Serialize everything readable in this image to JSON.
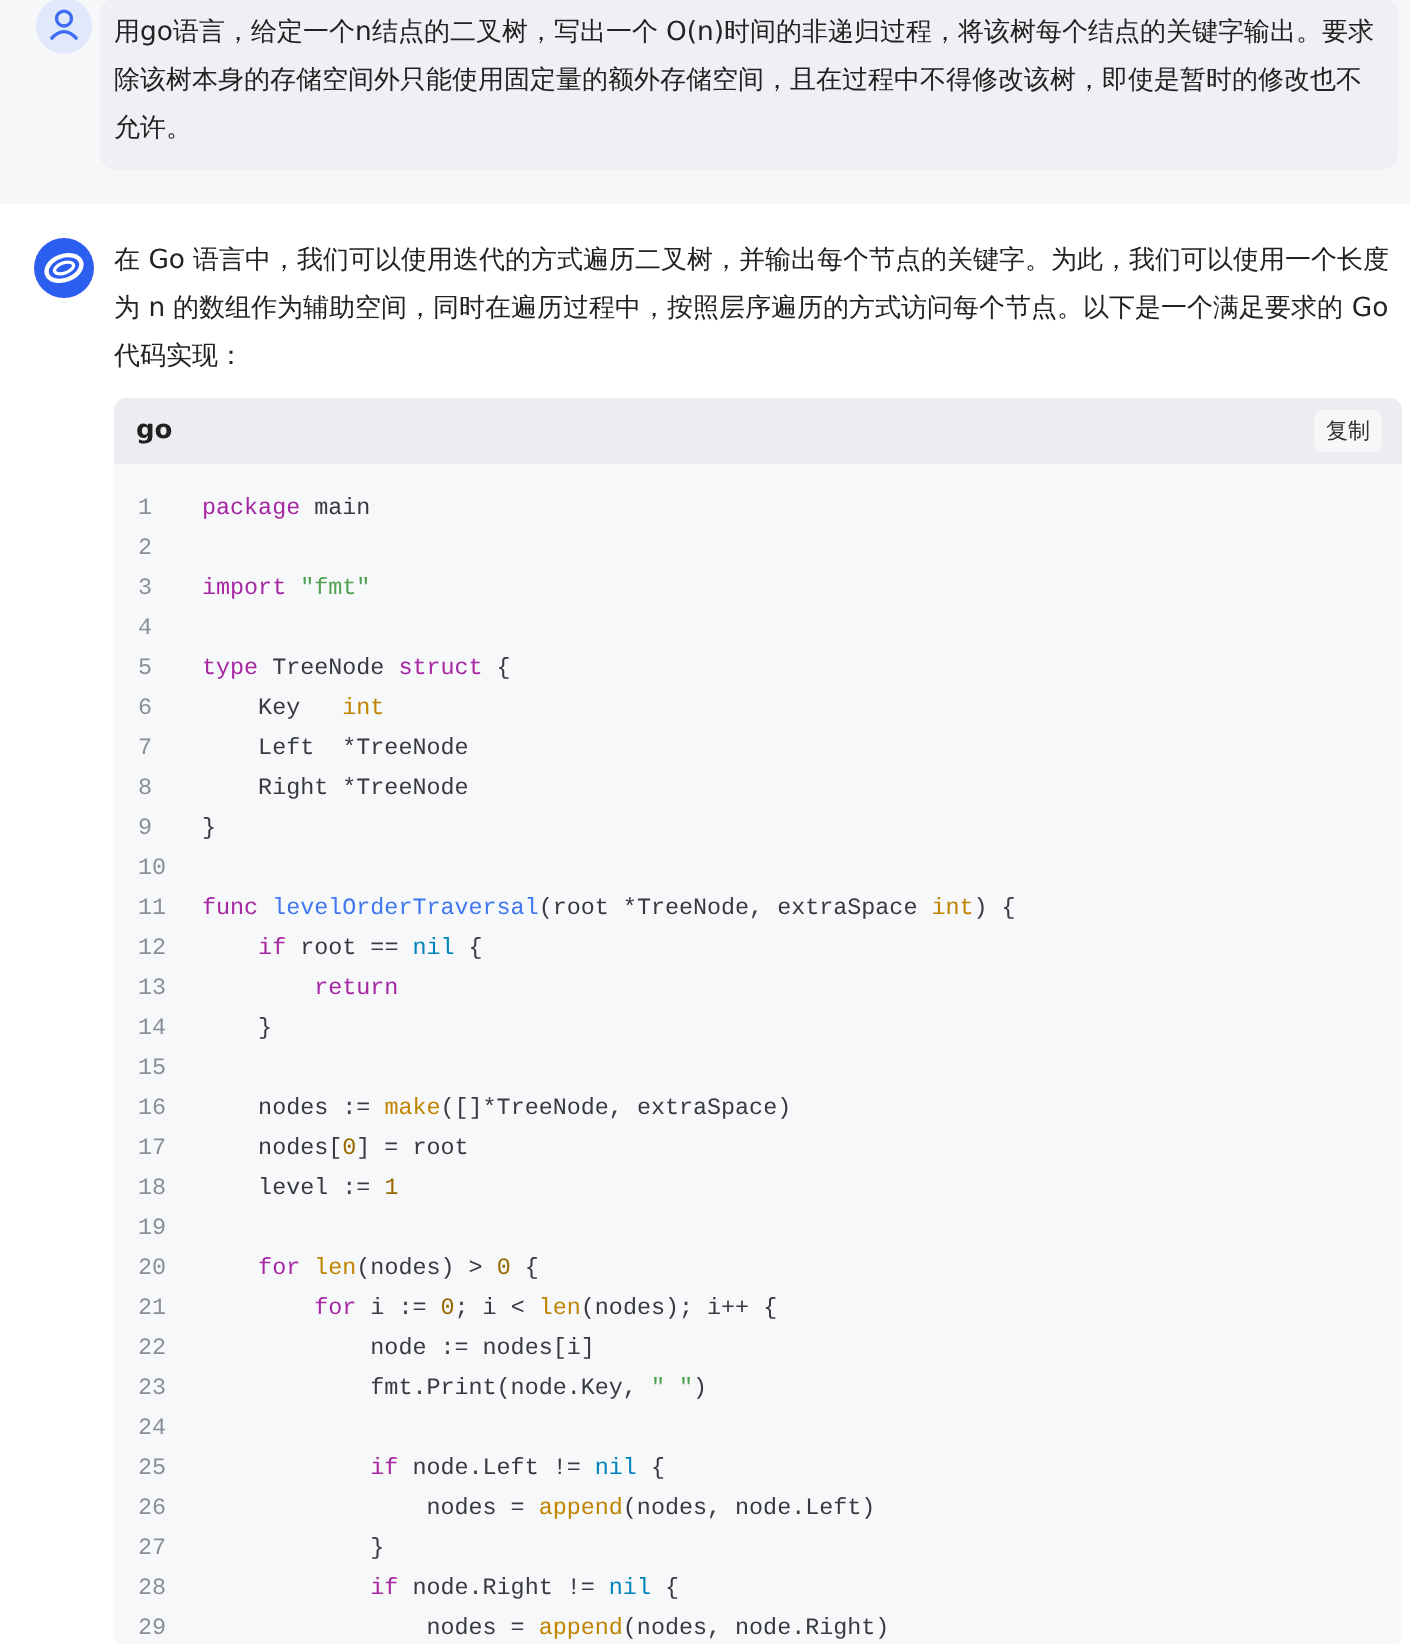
{
  "question": {
    "text": "用go语言，给定一个n结点的二叉树，写出一个 O(n)时间的非递归过程，将该树每个结点的关键字输出。要求除该树本身的存储空间外只能使用固定量的额外存储空间，且在过程中不得修改该树，即使是暂时的修改也不允许。"
  },
  "answer": {
    "text": "在 Go 语言中，我们可以使用迭代的方式遍历二叉树，并输出每个节点的关键字。为此，我们可以使用一个长度为 n 的数组作为辅助空间，同时在遍历过程中，按照层序遍历的方式访问每个节点。以下是一个满足要求的 Go 代码实现：",
    "code": {
      "language": "go",
      "copy_label": "复制",
      "lines": [
        {
          "number": "1",
          "tokens": [
            {
              "kind": "keyword",
              "text": "package"
            },
            {
              "kind": "plain",
              "text": " main"
            }
          ]
        },
        {
          "number": "2"
        },
        {
          "number": "3",
          "tokens": [
            {
              "kind": "keyword",
              "text": "import "
            },
            {
              "kind": "string",
              "text": "\"fmt\""
            }
          ]
        },
        {
          "number": "4"
        },
        {
          "number": "5",
          "tokens": [
            {
              "kind": "keyword",
              "text": "type"
            },
            {
              "kind": "plain",
              "text": " TreeNode "
            },
            {
              "kind": "keyword",
              "text": "struct"
            },
            {
              "kind": "plain",
              "text": " {"
            }
          ]
        },
        {
          "number": "6",
          "tokens": [
            {
              "kind": "plain",
              "text": "    Key   "
            },
            {
              "kind": "builtin",
              "text": "int"
            }
          ]
        },
        {
          "number": "7",
          "tokens": [
            {
              "kind": "plain",
              "text": "    Left  *TreeNode"
            }
          ]
        },
        {
          "number": "8",
          "tokens": [
            {
              "kind": "plain",
              "text": "    Right *TreeNode"
            }
          ]
        },
        {
          "number": "9",
          "tokens": [
            {
              "kind": "plain",
              "text": "}"
            }
          ]
        },
        {
          "number": "10"
        },
        {
          "number": "11",
          "tokens": [
            {
              "kind": "keyword",
              "text": "func"
            },
            {
              "kind": "function",
              "text": " levelOrderTraversal"
            },
            {
              "kind": "plain",
              "text": "(root *TreeNode, extraSpace "
            },
            {
              "kind": "builtin",
              "text": "int"
            },
            {
              "kind": "plain",
              "text": ") {"
            }
          ]
        },
        {
          "number": "12",
          "tokens": [
            {
              "kind": "keyword",
              "text": "    if"
            },
            {
              "kind": "plain",
              "text": " root == "
            },
            {
              "kind": "literal",
              "text": "nil"
            },
            {
              "kind": "plain",
              "text": " {"
            }
          ]
        },
        {
          "number": "13",
          "tokens": [
            {
              "kind": "keyword",
              "text": "        return"
            }
          ]
        },
        {
          "number": "14",
          "tokens": [
            {
              "kind": "plain",
              "text": "    }"
            }
          ]
        },
        {
          "number": "15"
        },
        {
          "number": "16",
          "tokens": [
            {
              "kind": "plain",
              "text": "    nodes := "
            },
            {
              "kind": "builtin",
              "text": "make"
            },
            {
              "kind": "plain",
              "text": "([]*TreeNode, extraSpace)"
            }
          ]
        },
        {
          "number": "17",
          "tokens": [
            {
              "kind": "plain",
              "text": "    nodes["
            },
            {
              "kind": "number",
              "text": "0"
            },
            {
              "kind": "plain",
              "text": "] = root"
            }
          ]
        },
        {
          "number": "18",
          "tokens": [
            {
              "kind": "plain",
              "text": "    level := "
            },
            {
              "kind": "number",
              "text": "1"
            }
          ]
        },
        {
          "number": "19"
        },
        {
          "number": "20",
          "tokens": [
            {
              "kind": "keyword",
              "text": "    for"
            },
            {
              "kind": "builtin",
              "text": " len"
            },
            {
              "kind": "plain",
              "text": "(nodes) > "
            },
            {
              "kind": "number",
              "text": "0"
            },
            {
              "kind": "plain",
              "text": " {"
            }
          ]
        },
        {
          "number": "21",
          "tokens": [
            {
              "kind": "keyword",
              "text": "        for"
            },
            {
              "kind": "plain",
              "text": " i := "
            },
            {
              "kind": "number",
              "text": "0"
            },
            {
              "kind": "plain",
              "text": "; i < "
            },
            {
              "kind": "builtin",
              "text": "len"
            },
            {
              "kind": "plain",
              "text": "(nodes); i++ {"
            }
          ]
        },
        {
          "number": "22",
          "tokens": [
            {
              "kind": "plain",
              "text": "            node := nodes[i]"
            }
          ]
        },
        {
          "number": "23",
          "tokens": [
            {
              "kind": "plain",
              "text": "            fmt.Print(node.Key, "
            },
            {
              "kind": "string",
              "text": "\" \""
            },
            {
              "kind": "plain",
              "text": ")"
            }
          ]
        },
        {
          "number": "24"
        },
        {
          "number": "25",
          "tokens": [
            {
              "kind": "keyword",
              "text": "            if"
            },
            {
              "kind": "plain",
              "text": " node.Left != "
            },
            {
              "kind": "literal",
              "text": "nil"
            },
            {
              "kind": "plain",
              "text": " {"
            }
          ]
        },
        {
          "number": "26",
          "tokens": [
            {
              "kind": "plain",
              "text": "                nodes = "
            },
            {
              "kind": "builtin",
              "text": "append"
            },
            {
              "kind": "plain",
              "text": "(nodes, node.Left)"
            }
          ]
        },
        {
          "number": "27",
          "tokens": [
            {
              "kind": "plain",
              "text": "            }"
            }
          ]
        },
        {
          "number": "28",
          "tokens": [
            {
              "kind": "keyword",
              "text": "            if"
            },
            {
              "kind": "plain",
              "text": " node.Right != "
            },
            {
              "kind": "literal",
              "text": "nil"
            },
            {
              "kind": "plain",
              "text": " {"
            }
          ]
        },
        {
          "number": "29",
          "tokens": [
            {
              "kind": "plain",
              "text": "                nodes = "
            },
            {
              "kind": "builtin",
              "text": "append"
            },
            {
              "kind": "plain",
              "text": "(nodes, node.Right)"
            }
          ]
        }
      ]
    }
  }
}
